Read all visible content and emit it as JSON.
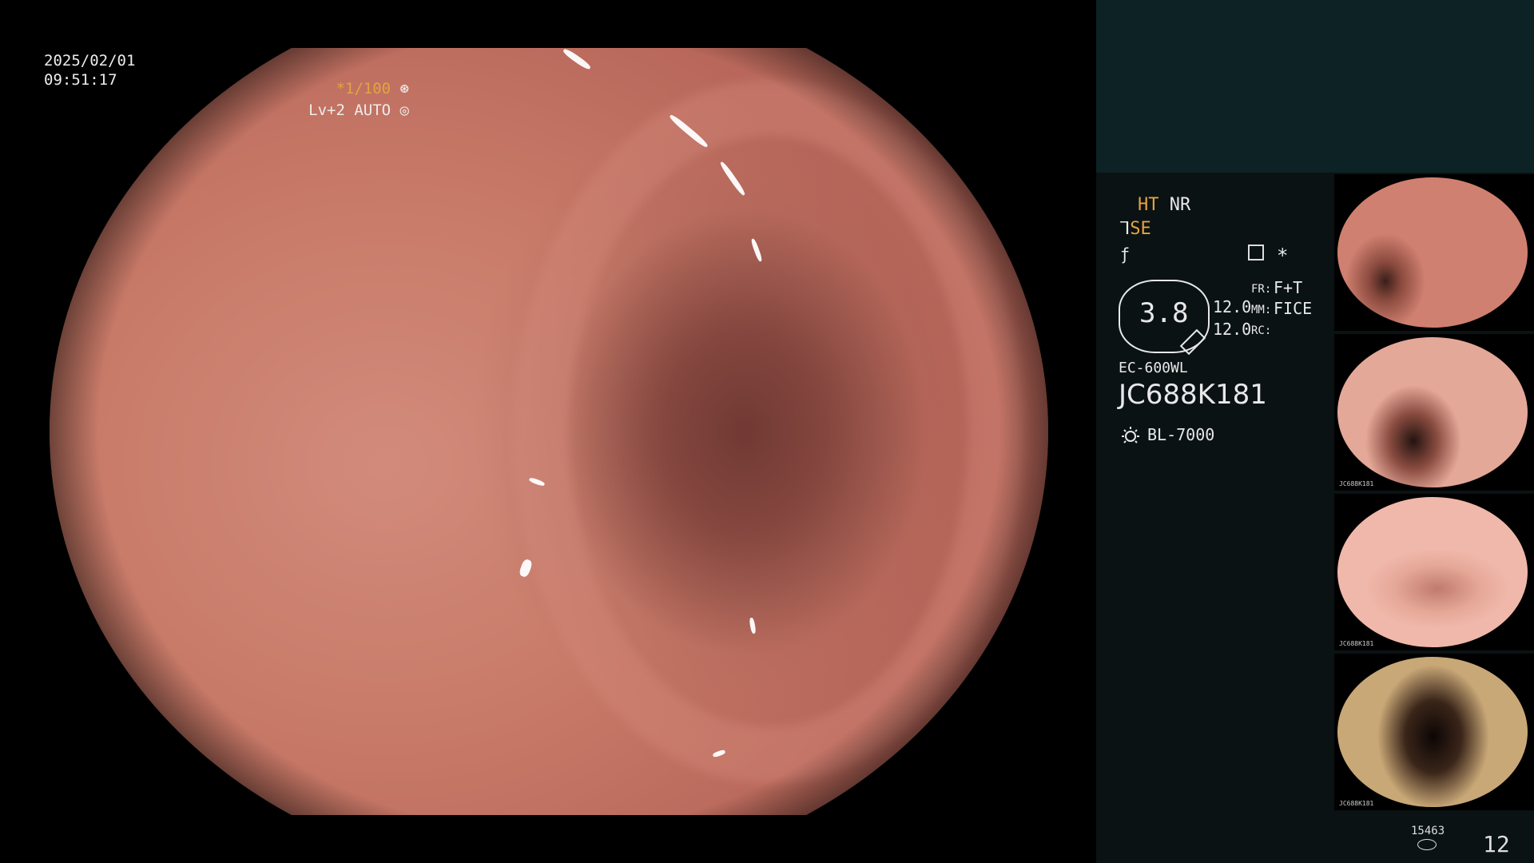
{
  "overlay": {
    "date": "2025/02/01",
    "time": "09:51:17",
    "shutter": "*1/100",
    "iris": "Lv+2 AUTO"
  },
  "panel": {
    "ht": "HT",
    "nr": "NR",
    "se": "SE",
    "zoom": "3.8",
    "value_1": "12.0",
    "value_2": "12.0",
    "fr_label": "FR:",
    "fr_value": "F+T",
    "mm_label": "MM:",
    "mm_value": "FICE",
    "rc_label": "RC:",
    "scope_model": "EC-600WL",
    "scope_serial": "JC688K181",
    "light_source": "BL-7000",
    "thumb_caption": "JC688K181"
  },
  "footer": {
    "count": "15463",
    "page": "12"
  },
  "colors": {
    "accent_orange": "#e7a23f",
    "panel_top": "#0d2224",
    "panel_bg": "#0a1213"
  },
  "icons": [
    "shutter-icon",
    "iris-icon",
    "structure-icon",
    "light-source-icon",
    "storage-icon"
  ]
}
